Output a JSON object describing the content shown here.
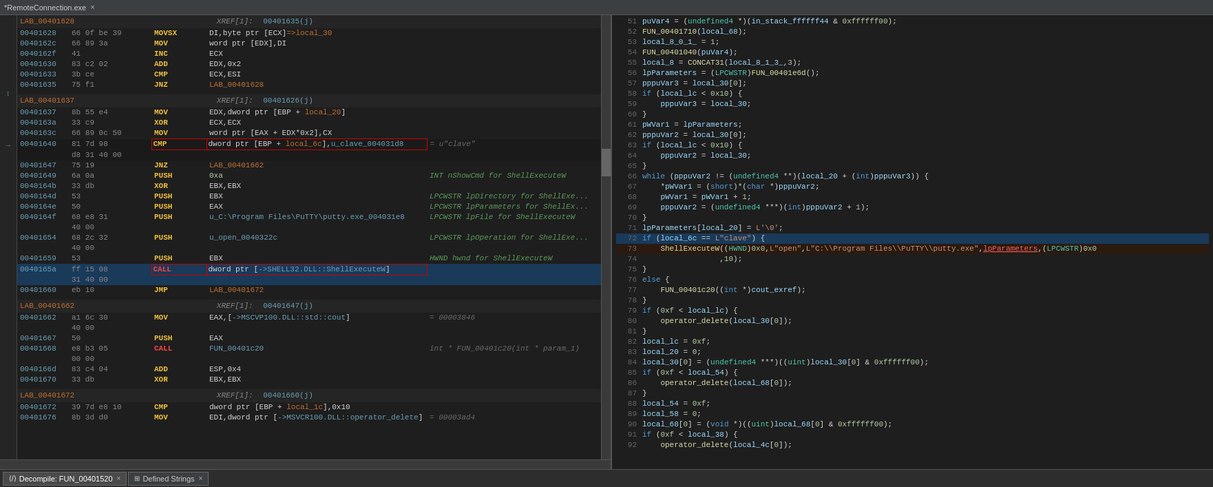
{
  "titleBar": {
    "text": "*RemoteConnection.exe",
    "closeLabel": "×"
  },
  "disasm": {
    "lines": [
      {
        "type": "label",
        "addr": "LAB_00401628",
        "xref": "XREF[1]:",
        "xref_addr": "00401635(j)"
      },
      {
        "type": "instr",
        "addr": "00401628",
        "bytes": "66 0f be 39",
        "mnem": "MOVSX",
        "ops": "DI,byte ptr [ECX]=>local_30",
        "comment": ""
      },
      {
        "type": "instr",
        "addr": "0040162c",
        "bytes": "66 89 3a",
        "mnem": "MOV",
        "ops": "word ptr [EDX],DI",
        "comment": ""
      },
      {
        "type": "instr",
        "addr": "0040162f",
        "bytes": "41",
        "mnem": "INC",
        "ops": "ECX",
        "comment": ""
      },
      {
        "type": "instr",
        "addr": "00401630",
        "bytes": "83 c2 02",
        "mnem": "ADD",
        "ops": "EDX,0x2",
        "comment": ""
      },
      {
        "type": "instr",
        "addr": "00401633",
        "bytes": "3b ce",
        "mnem": "CMP",
        "ops": "ECX,ESI",
        "comment": ""
      },
      {
        "type": "instr",
        "addr": "00401635",
        "bytes": "75 f1",
        "mnem": "JNZ",
        "ops": "LAB_00401628",
        "comment": ""
      },
      {
        "type": "spacer"
      },
      {
        "type": "label",
        "addr": "LAB_00401637",
        "xref": "XREF[1]:",
        "xref_addr": "00401626(j)"
      },
      {
        "type": "instr",
        "addr": "00401637",
        "bytes": "8b 55 e4",
        "mnem": "MOV",
        "ops": "EDX,dword ptr [EBP + local_20]",
        "comment": ""
      },
      {
        "type": "instr",
        "addr": "0040163a",
        "bytes": "33 c9",
        "mnem": "XOR",
        "ops": "ECX,ECX",
        "comment": ""
      },
      {
        "type": "instr",
        "addr": "0040163c",
        "bytes": "66 89 0c 50",
        "mnem": "MOV",
        "ops": "word ptr [EAX + EDX*0x2],CX",
        "comment": ""
      },
      {
        "type": "instr",
        "addr": "00401640",
        "bytes": "81 7d 98",
        "mnem": "CMP",
        "ops": "dword ptr [EBP + local_6c],u_clave_004031d8",
        "comment": "= u\"clave\"",
        "redbox": true
      },
      {
        "type": "instr",
        "addr": "",
        "bytes": "d8 31 40 00",
        "mnem": "",
        "ops": "",
        "comment": ""
      },
      {
        "type": "instr",
        "addr": "00401647",
        "bytes": "75 19",
        "mnem": "JNZ",
        "ops": "LAB_00401662",
        "comment": ""
      },
      {
        "type": "instr",
        "addr": "00401649",
        "bytes": "6a 0a",
        "mnem": "PUSH",
        "ops": "0xa",
        "comment": "INT nShowCmd for ShellExecuteW"
      },
      {
        "type": "instr",
        "addr": "0040164b",
        "bytes": "33 db",
        "mnem": "XOR",
        "ops": "EBX,EBX",
        "comment": ""
      },
      {
        "type": "instr",
        "addr": "0040164d",
        "bytes": "53",
        "mnem": "PUSH",
        "ops": "EBX",
        "comment": "LPCWSTR lpDirectory for ShellExe..."
      },
      {
        "type": "instr",
        "addr": "0040164e",
        "bytes": "50",
        "mnem": "PUSH",
        "ops": "EAX",
        "comment": "LPCWSTR lpParameters for ShellEx..."
      },
      {
        "type": "instr",
        "addr": "0040164f",
        "bytes": "68 e8 31",
        "mnem": "PUSH",
        "ops": "u_C:\\Program Files\\PuTTY\\putty.exe_004031e8",
        "comment": "LPCWSTR lpFile for ShellExecuteW"
      },
      {
        "type": "instr",
        "addr": "",
        "bytes": "40 00",
        "mnem": "",
        "ops": "",
        "comment": ""
      },
      {
        "type": "instr",
        "addr": "00401654",
        "bytes": "68 2c 32",
        "mnem": "PUSH",
        "ops": "u_open_0040322c",
        "comment": "LPCWSTR lpOperation for ShellExe..."
      },
      {
        "type": "instr",
        "addr": "",
        "bytes": "40 00",
        "mnem": "",
        "ops": "",
        "comment": ""
      },
      {
        "type": "instr",
        "addr": "00401659",
        "bytes": "53",
        "mnem": "PUSH",
        "ops": "EBX",
        "comment": "HWND hwnd for ShellExecuteW"
      },
      {
        "type": "instr",
        "addr": "0040165a",
        "bytes": "ff 15 08",
        "mnem": "CALL",
        "ops": "dword ptr [->SHELL32.DLL::ShellExecuteW]",
        "comment": "",
        "call": true,
        "selected": true
      },
      {
        "type": "instr",
        "addr": "",
        "bytes": "31 40 00",
        "mnem": "",
        "ops": "",
        "comment": ""
      },
      {
        "type": "instr",
        "addr": "00401660",
        "bytes": "eb 10",
        "mnem": "JMP",
        "ops": "LAB_00401672",
        "comment": ""
      },
      {
        "type": "spacer"
      },
      {
        "type": "label",
        "addr": "LAB_00401662",
        "xref": "XREF[1]:",
        "xref_addr": "00401647(j)"
      },
      {
        "type": "instr",
        "addr": "00401662",
        "bytes": "a1 6c 30",
        "mnem": "MOV",
        "ops": "EAX,[->MSCVP100.DLL::std::cout]",
        "comment": "= 00003846"
      },
      {
        "type": "instr",
        "addr": "",
        "bytes": "40 00",
        "mnem": "",
        "ops": "",
        "comment": ""
      },
      {
        "type": "instr",
        "addr": "00401667",
        "bytes": "50",
        "mnem": "PUSH",
        "ops": "EAX",
        "comment": ""
      },
      {
        "type": "instr",
        "addr": "00401668",
        "bytes": "e8 b3 05",
        "mnem": "CALL",
        "ops": "FUN_00401c20",
        "comment": "int * FUN_00401c20(int * param_1)",
        "call2": true
      },
      {
        "type": "instr",
        "addr": "",
        "bytes": "00 00",
        "mnem": "",
        "ops": "",
        "comment": ""
      },
      {
        "type": "instr",
        "addr": "0040166d",
        "bytes": "83 c4 04",
        "mnem": "ADD",
        "ops": "ESP,0x4",
        "comment": ""
      },
      {
        "type": "instr",
        "addr": "00401670",
        "bytes": "33 db",
        "mnem": "XOR",
        "ops": "EBX,EBX",
        "comment": ""
      },
      {
        "type": "spacer"
      },
      {
        "type": "label",
        "addr": "LAB_00401672",
        "xref": "XREF[1]:",
        "xref_addr": "00401660(j)"
      },
      {
        "type": "instr",
        "addr": "00401672",
        "bytes": "39 7d e8 10",
        "mnem": "CMP",
        "ops": "dword ptr [EBP + local_1c],0x10",
        "comment": ""
      },
      {
        "type": "instr",
        "addr": "00401676",
        "bytes": "8b 3d d0",
        "mnem": "MOV",
        "ops": "EDI,dword ptr [->MSVCR100.DLL::operator_delete]",
        "comment": "= 00003ad4"
      }
    ]
  },
  "decompile": {
    "funcName": "FUN_00401520",
    "lines": [
      {
        "num": 51,
        "text": "puVar4 = (undefined4 *)(in_stack_ffffff44 & 0xffffff00);",
        "indent": 0
      },
      {
        "num": 52,
        "text": "FUN_00401710(local_68);",
        "indent": 0
      },
      {
        "num": 53,
        "text": "local_8_0_1_ = 1;",
        "indent": 0
      },
      {
        "num": 54,
        "text": "FUN_00401040(puVar4);",
        "indent": 0
      },
      {
        "num": 55,
        "text": "local_8 = CONCAT31(local_8_1_3_,3);",
        "indent": 0
      },
      {
        "num": 56,
        "text": "lpParameters = (LPCWSTR)FUN_00401e6d();",
        "indent": 0
      },
      {
        "num": 57,
        "text": "pppuVar3 = local_30[0];",
        "indent": 0
      },
      {
        "num": 58,
        "text": "if (local_lc < 0x10) {",
        "indent": 0
      },
      {
        "num": 59,
        "text": "    pppuVar3 = local_30;",
        "indent": 1
      },
      {
        "num": 60,
        "text": "}",
        "indent": 0
      },
      {
        "num": 61,
        "text": "pWVar1 = lpParameters;",
        "indent": 0
      },
      {
        "num": 62,
        "text": "pppuVar2 = local_30[0];",
        "indent": 0
      },
      {
        "num": 63,
        "text": "if (local_lc < 0x10) {",
        "indent": 0
      },
      {
        "num": 64,
        "text": "    pppuVar2 = local_30;",
        "indent": 1
      },
      {
        "num": 65,
        "text": "}",
        "indent": 0
      },
      {
        "num": 66,
        "text": "while (pppuVar2 != (undefined4 **)(local_20 + (int)pppuVar3)) {",
        "indent": 0
      },
      {
        "num": 67,
        "text": "    *pWVar1 = (short)*(char *)pppuVar2;",
        "indent": 1
      },
      {
        "num": 68,
        "text": "    pWVar1 = pWVar1 + 1;",
        "indent": 1
      },
      {
        "num": 69,
        "text": "    pppuVar2 = (undefined4 ***)(int)pppuVar2 + 1);",
        "indent": 1
      },
      {
        "num": 70,
        "text": "}",
        "indent": 0
      },
      {
        "num": 71,
        "text": "lpParameters[local_20] = L'\\0';",
        "indent": 0
      },
      {
        "num": 72,
        "text": "if (local_6c == L\"clave\") {",
        "indent": 0,
        "highlight": true
      },
      {
        "num": 73,
        "text": "    ShellExecuteW((HWND)0x0,L\"open\",L\"C:\\\\Program Files\\\\PuTTY\\\\putty.exe\",lpParameters,(LPCWSTR)0x0",
        "indent": 1,
        "highlight2": true
      },
      {
        "num": 74,
        "text": "                 ,10);",
        "indent": 2
      },
      {
        "num": 75,
        "text": "}",
        "indent": 0
      },
      {
        "num": 76,
        "text": "else {",
        "indent": 0
      },
      {
        "num": 77,
        "text": "    FUN_00401c20((int *)cout_exref);",
        "indent": 1
      },
      {
        "num": 78,
        "text": "}",
        "indent": 0
      },
      {
        "num": 79,
        "text": "if (0xf < local_lc) {",
        "indent": 0
      },
      {
        "num": 80,
        "text": "    operator_delete(local_30[0]);",
        "indent": 1
      },
      {
        "num": 81,
        "text": "}",
        "indent": 0
      },
      {
        "num": 82,
        "text": "local_lc = 0xf;",
        "indent": 0
      },
      {
        "num": 83,
        "text": "local_20 = 0;",
        "indent": 0
      },
      {
        "num": 84,
        "text": "local_30[0] = (undefined4 ***)((uint)local_30[0] & 0xffffff00);",
        "indent": 0
      },
      {
        "num": 85,
        "text": "if (0xf < local_54) {",
        "indent": 0
      },
      {
        "num": 86,
        "text": "    operator_delete(local_68[0]);",
        "indent": 1
      },
      {
        "num": 87,
        "text": "}",
        "indent": 0
      },
      {
        "num": 88,
        "text": "local_54 = 0xf;",
        "indent": 0
      },
      {
        "num": 89,
        "text": "local_58 = 0;",
        "indent": 0
      },
      {
        "num": 90,
        "text": "local_68[0] = (void *)((uint)local_68[0] & 0xffffff00);",
        "indent": 0
      },
      {
        "num": 91,
        "text": "if (0xf < local_38) {",
        "indent": 0
      },
      {
        "num": 92,
        "text": "    operator_delete(local_4c[0]);",
        "indent": 1
      }
    ]
  },
  "bottomBar": {
    "tabs": [
      {
        "label": "Decompile: FUN_00401520",
        "icon": "code",
        "active": true,
        "closable": true
      },
      {
        "label": "Defined Strings",
        "icon": "grid",
        "active": false,
        "closable": true
      }
    ]
  },
  "annotations": {
    "clave_comment": "= u\"clave\"",
    "nShowCmd": "INT nShowCmd for ShellExecuteW",
    "lpDirectory": "LPCWSTR lpDirectory for ShellExe...",
    "lpParameters": "LPCWSTR lpParameters for ShellEx...",
    "lpFile": "LPCWSTR lpFile for ShellExecuteW",
    "lpOperation": "LPCWSTR lpOperation for ShellExe...",
    "hwnd": "HWND hwnd for ShellExecuteW",
    "cout_comment": "= 00003846",
    "fun_comment": "int * FUN_00401c20(int * param_1)"
  }
}
